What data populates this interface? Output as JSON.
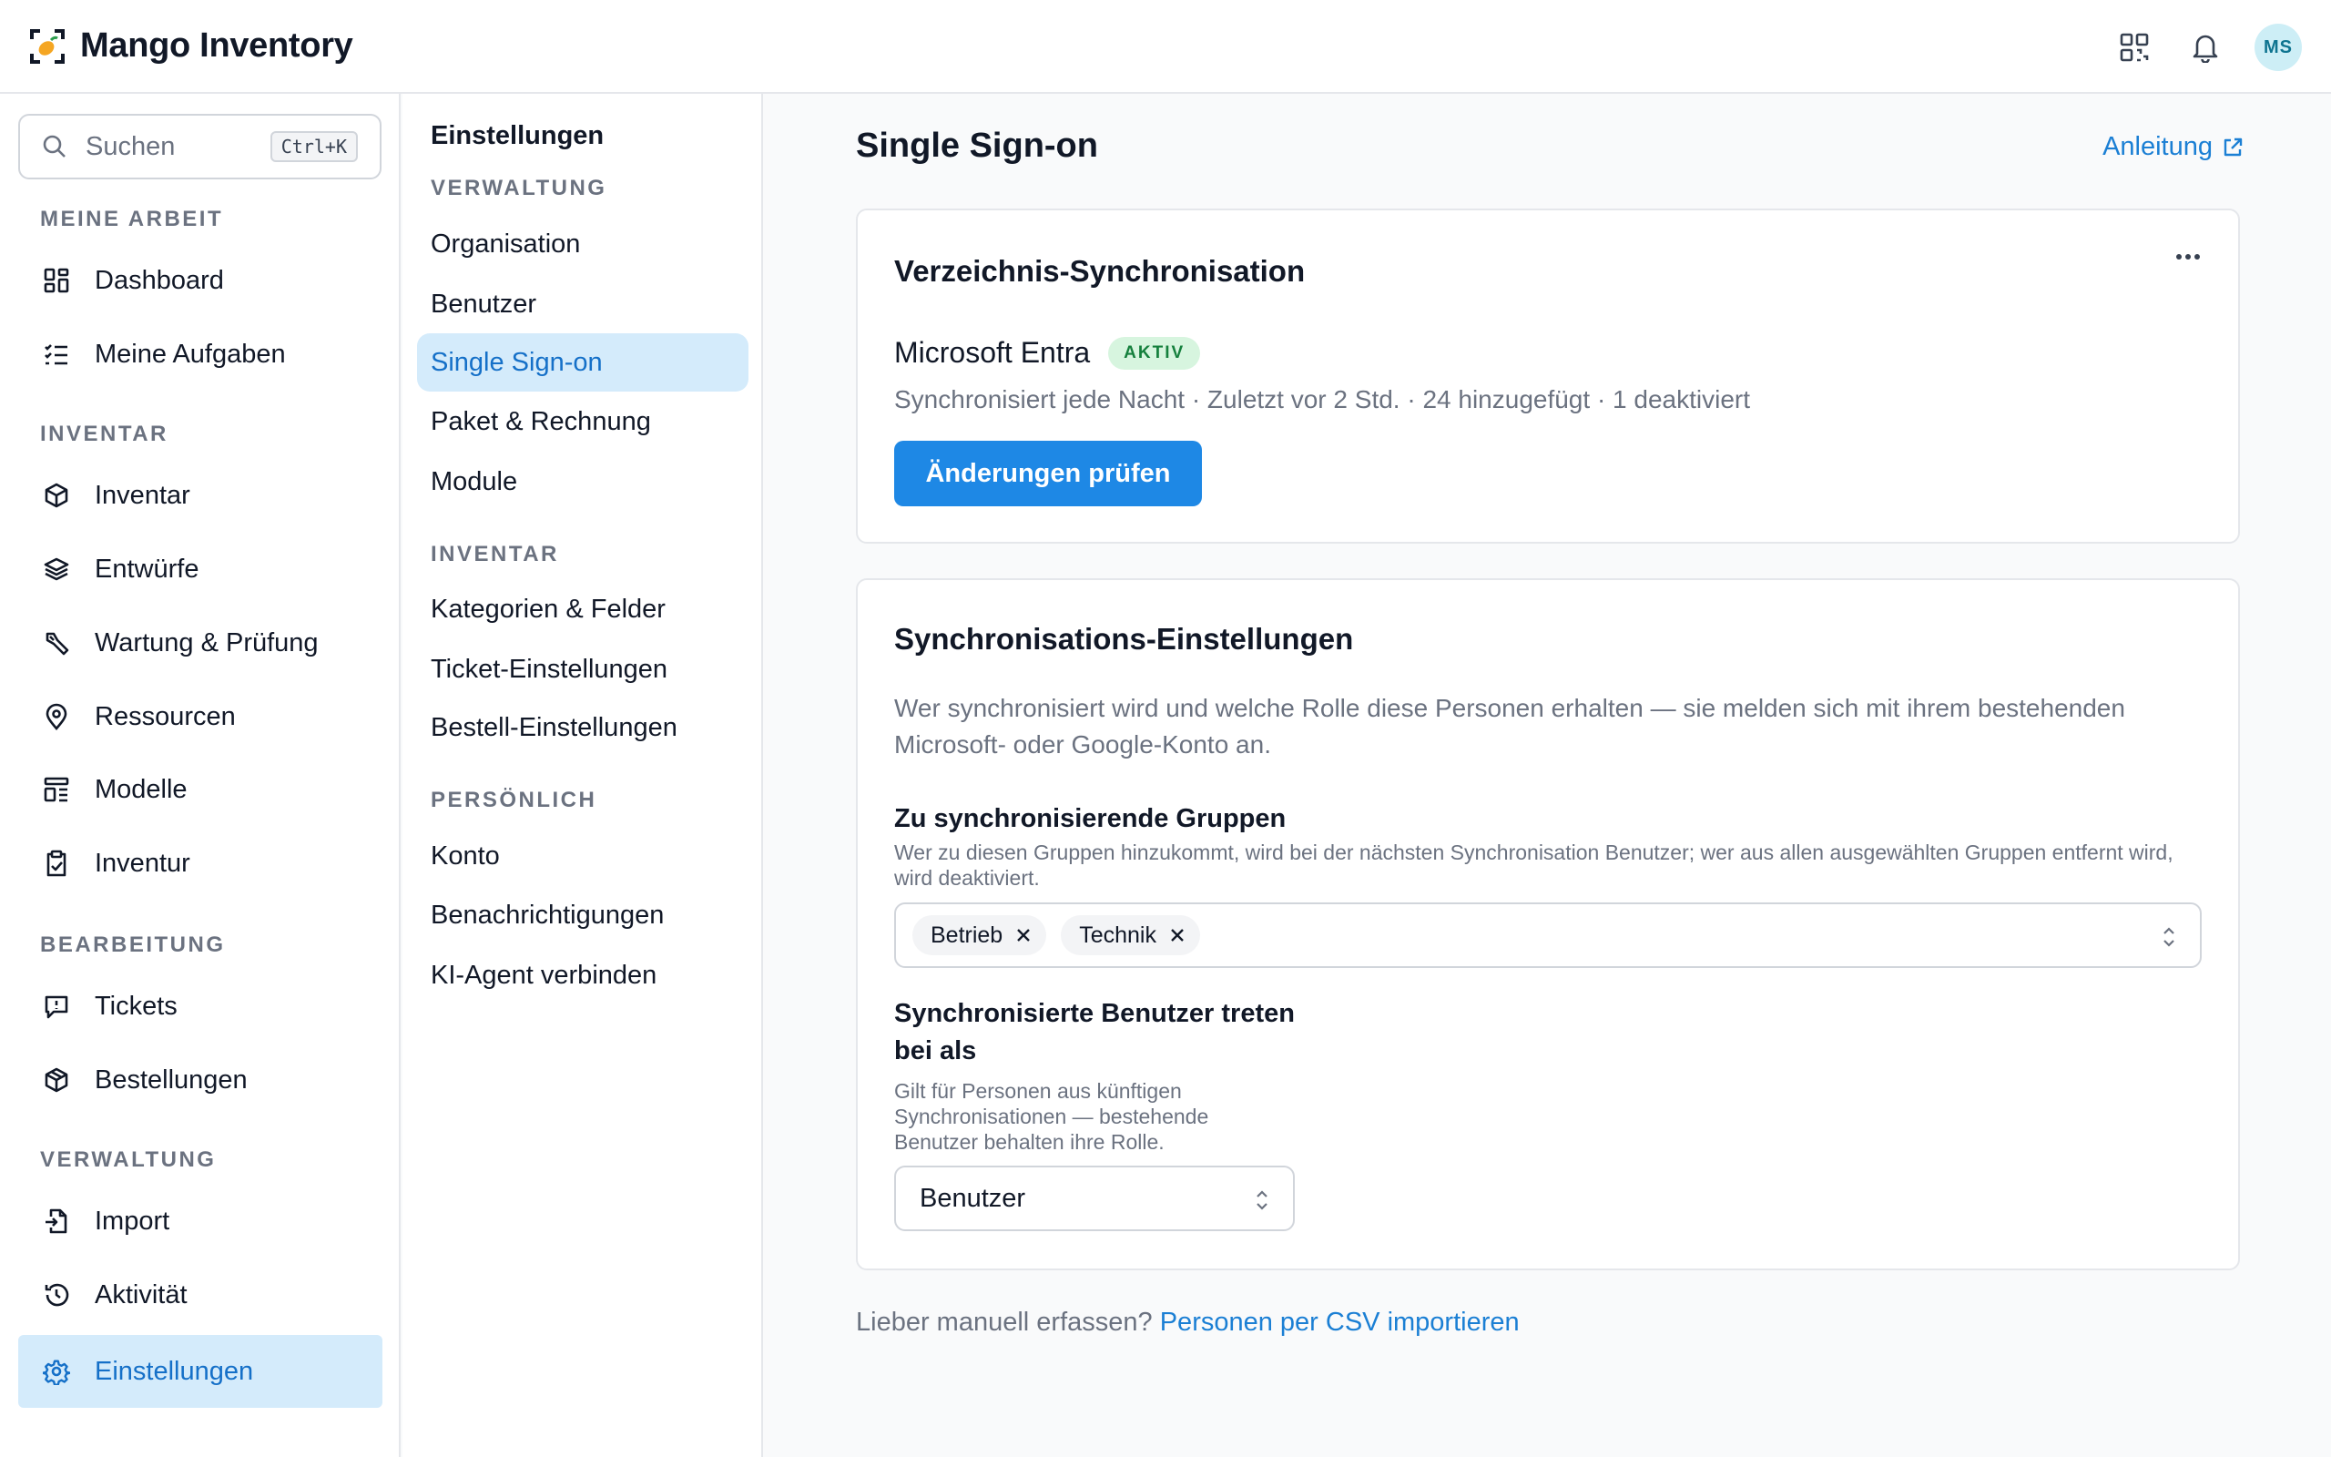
{
  "app": {
    "name": "Mango Inventory",
    "user_initials": "MS",
    "logo_icon": "mango-logo-icon"
  },
  "topbar": {
    "icons": [
      "qr-code-icon",
      "bell-icon"
    ]
  },
  "search": {
    "placeholder": "Suchen",
    "shortcut": "Ctrl+K"
  },
  "sidebar": {
    "sections": [
      {
        "label": "MEINE ARBEIT",
        "items": [
          {
            "label": "Dashboard",
            "icon": "dashboard-icon"
          },
          {
            "label": "Meine Aufgaben",
            "icon": "tasks-icon"
          }
        ]
      },
      {
        "label": "INVENTAR",
        "items": [
          {
            "label": "Inventar",
            "icon": "box-icon"
          },
          {
            "label": "Entwürfe",
            "icon": "layers-icon"
          },
          {
            "label": "Wartung & Prüfung",
            "icon": "wrench-icon"
          },
          {
            "label": "Ressourcen",
            "icon": "map-pin-icon"
          },
          {
            "label": "Modelle",
            "icon": "template-icon"
          },
          {
            "label": "Inventur",
            "icon": "clipboard-check-icon"
          }
        ]
      },
      {
        "label": "BEARBEITUNG",
        "items": [
          {
            "label": "Tickets",
            "icon": "ticket-alert-icon"
          },
          {
            "label": "Bestellungen",
            "icon": "package-icon"
          }
        ]
      },
      {
        "label": "VERWALTUNG",
        "items": [
          {
            "label": "Import",
            "icon": "file-import-icon"
          },
          {
            "label": "Aktivität",
            "icon": "history-icon"
          },
          {
            "label": "Einstellungen",
            "icon": "gear-icon",
            "active": true
          }
        ]
      }
    ]
  },
  "settings_nav": {
    "title": "Einstellungen",
    "sections": [
      {
        "label": "VERWALTUNG",
        "items": [
          "Organisation",
          "Benutzer",
          "Single Sign-on",
          "Paket & Rechnung",
          "Module"
        ]
      },
      {
        "label": "INVENTAR",
        "items": [
          "Kategorien & Felder",
          "Ticket-Einstellungen",
          "Bestell-Einstellungen"
        ]
      },
      {
        "label": "PERSÖNLICH",
        "items": [
          "Konto",
          "Benachrichtigungen",
          "KI-Agent verbinden"
        ]
      }
    ],
    "active": "Single Sign-on"
  },
  "main": {
    "title": "Single Sign-on",
    "guide_link": "Anleitung",
    "directory_card": {
      "title": "Verzeichnis-Synchronisation",
      "provider": "Microsoft Entra",
      "status_badge": "AKTIV",
      "meta": "Synchronisiert jede Nacht · Zuletzt vor 2 Std. · 24 hinzugefügt · 1 deaktiviert",
      "review_button": "Änderungen prüfen"
    },
    "sync_settings": {
      "title": "Synchronisations-Einstellungen",
      "description": "Wer synchronisiert wird und welche Rolle diese Personen erhalten — sie melden sich mit ihrem bestehenden Microsoft- oder Google-Konto an.",
      "groups_label": "Zu synchronisierende Gruppen",
      "groups_help": "Wer zu diesen Gruppen hinzukommt, wird bei der nächsten Synchronisation Benutzer; wer aus allen ausgewählten Gruppen entfernt wird, wird deaktiviert.",
      "groups": [
        "Betrieb",
        "Technik"
      ],
      "role_label_line1": "Synchronisierte Benutzer treten",
      "role_label_line2": "bei als",
      "role_help_line1": "Gilt für Personen aus künftigen",
      "role_help_line2": "Synchronisationen — bestehende",
      "role_help_line3": "Benutzer behalten ihre Rolle.",
      "role_value": "Benutzer"
    },
    "footer_text": "Lieber manuell erfassen?",
    "footer_link": "Personen per CSV importieren"
  },
  "colors": {
    "accent": "#1e88e5",
    "link": "#1b7fd4",
    "active_bg": "#d4ebfb",
    "badge_bg": "#d7f5df",
    "badge_text": "#15803d"
  }
}
